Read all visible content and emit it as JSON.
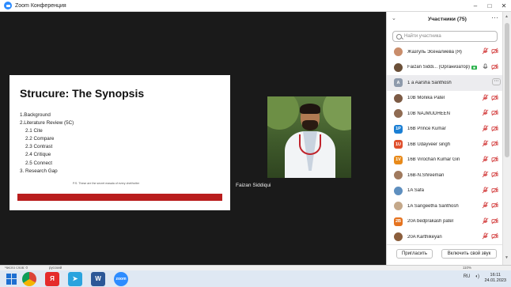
{
  "window": {
    "title": "Zoom Конференция",
    "controls": {
      "minimize": "–",
      "maximize": "□",
      "close": "✕"
    },
    "colors": {
      "accent": "#2d8cff",
      "slide_bar": "#b91d1d"
    }
  },
  "slide": {
    "title": "Strucure: The Synopsis",
    "items": [
      {
        "text": "1.Background",
        "indent": false
      },
      {
        "text": "2.Literature Review (5C)",
        "indent": false
      },
      {
        "text": "2.1 Cite",
        "indent": true
      },
      {
        "text": "2.2 Compare",
        "indent": true
      },
      {
        "text": "2.3 Contrast",
        "indent": true
      },
      {
        "text": "2.4 Critique",
        "indent": true
      },
      {
        "text": "2.5 Connect",
        "indent": true
      },
      {
        "text": "3. Research Gap",
        "indent": false
      }
    ],
    "note": "P.S. These are the secret masala of every chef/writer"
  },
  "video": {
    "name": "Faizan Siddiqui"
  },
  "panel": {
    "collapse_icon": "chevron-down-icon",
    "title": "Участники (75)",
    "more_icon": "more-icon",
    "search_placeholder": "Найти участника",
    "participants": [
      {
        "name": "Жазгуль Эсеналиева (Я)",
        "avatar_text": "",
        "avatar_color": "#c98d6b",
        "photo": true
      },
      {
        "name": "Faizan Siddi... (Организатор)",
        "avatar_text": "",
        "avatar_color": "#6b5038",
        "photo": true,
        "badge": true,
        "host": true
      },
      {
        "name": "1 a Aarsha Santhosh",
        "avatar_text": "A",
        "avatar_color": "#8e9aab",
        "selected": true
      },
      {
        "name": "10B Monika Patel",
        "avatar_text": "",
        "avatar_color": "#7c5a44",
        "photo": true
      },
      {
        "name": "10B NAJMUDHEEN",
        "avatar_text": "",
        "avatar_color": "#8f6b52",
        "photo": true
      },
      {
        "name": "16B Prince Kumar",
        "avatar_text": "1P",
        "avatar_color": "#1b7fd4"
      },
      {
        "name": "16B Udayveer singh",
        "avatar_text": "1U",
        "avatar_color": "#e04f2c"
      },
      {
        "name": "16B Virochan Kumar Giri",
        "avatar_text": "1V",
        "avatar_color": "#e88a1a"
      },
      {
        "name": "16B-N.Shreeman",
        "avatar_text": "",
        "avatar_color": "#a07a5e",
        "photo": true
      },
      {
        "name": "1A Safa",
        "avatar_text": "",
        "avatar_color": "#5e8fbf",
        "photo": true
      },
      {
        "name": "1A Sangeetha Santhosh",
        "avatar_text": "",
        "avatar_color": "#c4a88a",
        "photo": true
      },
      {
        "name": "20A bedprakash patel",
        "avatar_text": "2B",
        "avatar_color": "#e5731f"
      },
      {
        "name": "20A Karthikeyan",
        "avatar_text": "",
        "avatar_color": "#8b5e3c",
        "photo": true
      }
    ],
    "badge_label": "■",
    "invite_button": "Пригласить",
    "unmute_button": "Включить свой звук"
  },
  "statusbar": {
    "left": "Число слов: 0",
    "lang": "русский",
    "zoom": "110%"
  },
  "taskbar": {
    "apps": [
      {
        "icon": "chrome-icon",
        "label": "",
        "color": "#3c9e4a"
      },
      {
        "icon": "yandex-icon",
        "label": "Я",
        "color": "#e52b2b"
      },
      {
        "icon": "telegram-icon",
        "label": "➤",
        "color": "#2aa3de"
      },
      {
        "icon": "word-icon",
        "label": "W",
        "color": "#2b5797"
      },
      {
        "icon": "zoom-icon",
        "label": "zoom",
        "color": "#2d8cff"
      }
    ],
    "tray_lang": "RU",
    "time": "16:11",
    "date": "24.01.2023"
  }
}
